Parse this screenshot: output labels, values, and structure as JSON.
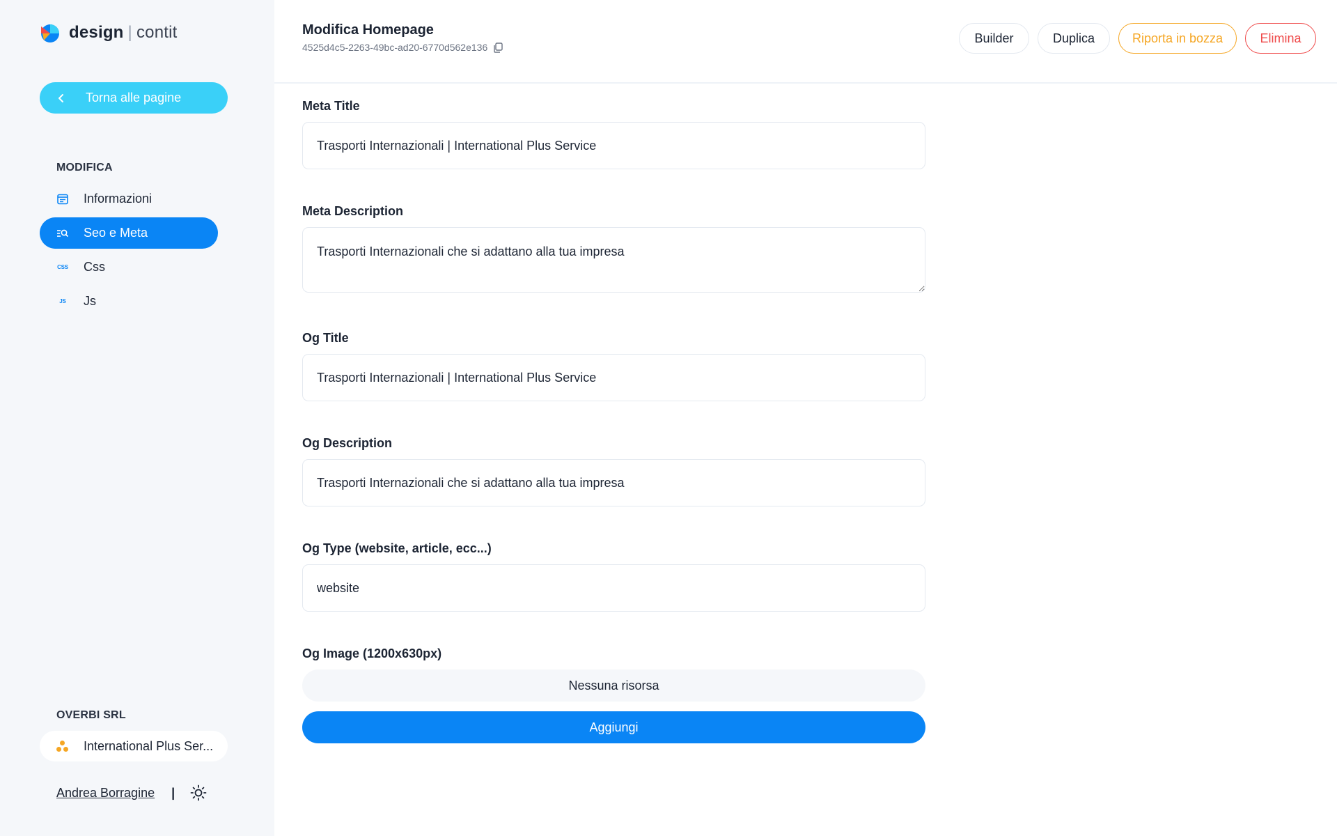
{
  "app": {
    "brand": "design",
    "brand_sub": "contit"
  },
  "sidebar": {
    "back_label": "Torna alle pagine",
    "section_label": "MODIFICA",
    "items": [
      {
        "label": "Informazioni",
        "icon": "info-card-icon"
      },
      {
        "label": "Seo e Meta",
        "icon": "seo-search-icon",
        "active": true
      },
      {
        "label": "Css",
        "icon": "css-icon",
        "tag": "CSS"
      },
      {
        "label": "Js",
        "icon": "js-icon",
        "tag": "JS"
      }
    ],
    "org_label": "OVERBI SRL",
    "site_label": "International Plus Ser...",
    "user_name": "Andrea Borragine",
    "user_sep": "|"
  },
  "header": {
    "title": "Modifica Homepage",
    "page_id": "4525d4c5-2263-49bc-ad20-6770d562e136",
    "buttons": {
      "builder": "Builder",
      "duplica": "Duplica",
      "bozza": "Riporta in bozza",
      "elimina": "Elimina"
    }
  },
  "form": {
    "meta_title_label": "Meta Title",
    "meta_title_value": "Trasporti Internazionali | International Plus Service",
    "meta_description_label": "Meta Description",
    "meta_description_value": "Trasporti Internazionali che si adattano alla tua impresa",
    "og_title_label": "Og Title",
    "og_title_value": "Trasporti Internazionali | International Plus Service",
    "og_description_label": "Og Description",
    "og_description_value": "Trasporti Internazionali che si adattano alla tua impresa",
    "og_type_label": "Og Type (website, article, ecc...)",
    "og_type_value": "website",
    "og_image_label": "Og Image (1200x630px)",
    "no_resource_text": "Nessuna risorsa",
    "add_button": "Aggiungi"
  },
  "colors": {
    "primary": "#0a85f5",
    "back_button": "#3ad0f8",
    "warning": "#f5a623",
    "danger": "#ef4a4a",
    "sidebar_bg": "#f5f7fa"
  }
}
